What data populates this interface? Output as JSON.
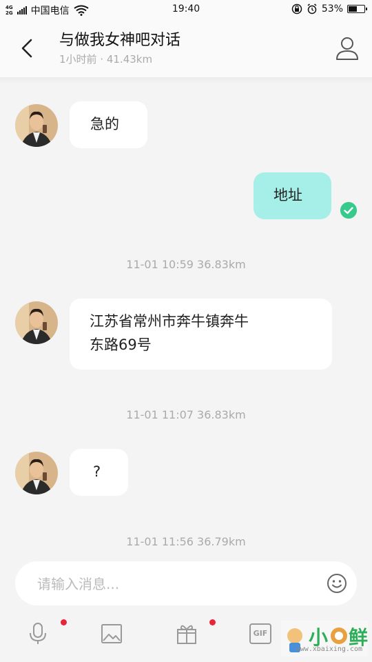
{
  "status_bar": {
    "network_top": "4G",
    "network_bottom": "2G",
    "carrier": "中国电信",
    "time": "19:40",
    "battery_percent": "53%",
    "battery_level": 0.53
  },
  "header": {
    "title": "与做我女神吧对话",
    "subtitle": "1小时前 · 41.43km"
  },
  "messages": [
    {
      "direction": "in",
      "text": "急的"
    },
    {
      "direction": "out",
      "text": "地址",
      "status": "read"
    },
    {
      "type": "timestamp",
      "text": "11-01 10:59  36.83km"
    },
    {
      "direction": "in",
      "text_line1": "江苏省常州市奔牛镇奔牛",
      "text_line2": "东路69号"
    },
    {
      "type": "timestamp",
      "text": "11-01 11:07  36.83km"
    },
    {
      "direction": "in",
      "text": "?"
    },
    {
      "type": "timestamp",
      "text": "11-01 11:56  36.79km"
    }
  ],
  "input": {
    "placeholder": "请输入消息...",
    "value": ""
  },
  "toolbar": {
    "items": [
      "microphone-icon",
      "image-icon",
      "gift-icon",
      "gif-icon",
      "more-icon"
    ],
    "gif_label": "GIF"
  },
  "watermark": {
    "chars": "小日鲜",
    "url": "www.xbaixing.com"
  },
  "colors": {
    "outgoing_bubble": "#a6efe9",
    "read_check": "#38c98c",
    "notification_dot": "#e8263a"
  }
}
